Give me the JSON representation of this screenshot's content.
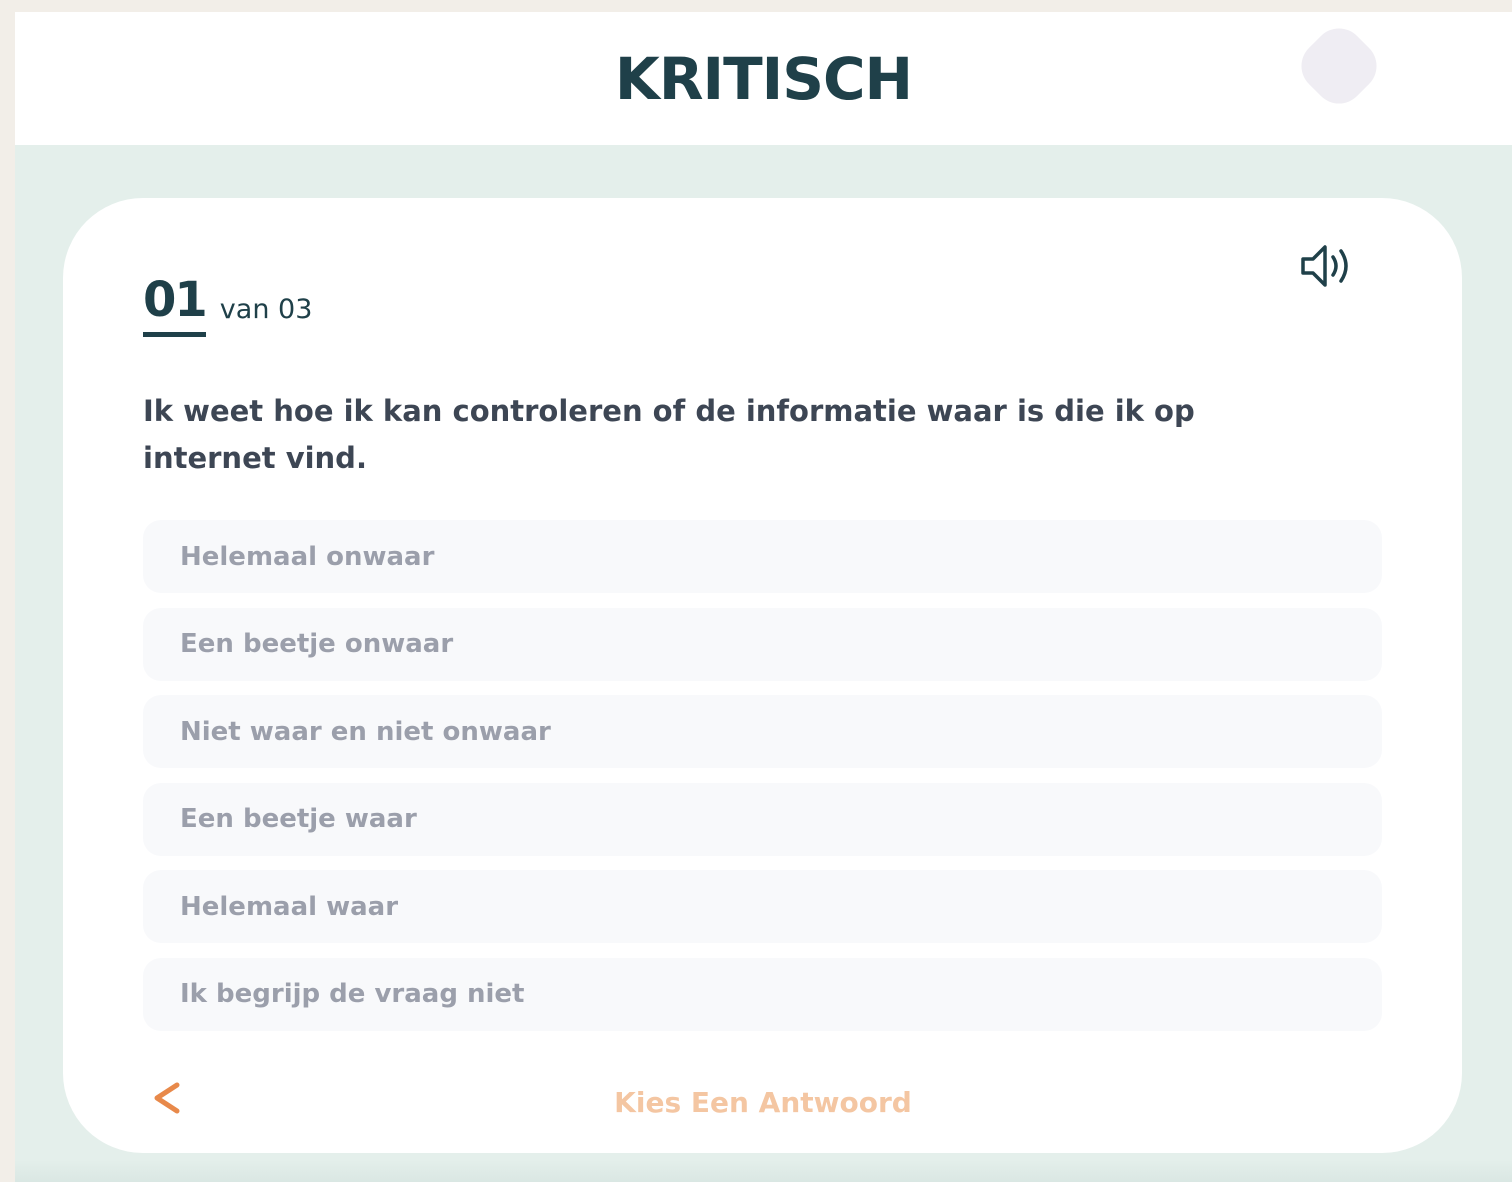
{
  "header": {
    "logo_text": "KRITISCH",
    "avatar_icon": "avatar-blob-icon"
  },
  "quiz": {
    "progress": {
      "current": "01",
      "total_label": "van 03"
    },
    "sound_icon": "speaker-icon",
    "question": "Ik weet hoe ik kan controleren of de informatie waar is die ik op internet vind.",
    "options": [
      {
        "label": "Helemaal onwaar"
      },
      {
        "label": "Een beetje onwaar"
      },
      {
        "label": "Niet waar en niet onwaar"
      },
      {
        "label": "Een beetje waar"
      },
      {
        "label": "Helemaal waar"
      },
      {
        "label": "Ik begrijp de vraag niet"
      }
    ],
    "back_label": "<",
    "submit_label": "Kies Een Antwoord"
  },
  "colors": {
    "brand_dark": "#1f4049",
    "accent_orange": "#e8894a",
    "disabled_orange": "#f4c6a2",
    "background_mint": "#e4efeb"
  }
}
